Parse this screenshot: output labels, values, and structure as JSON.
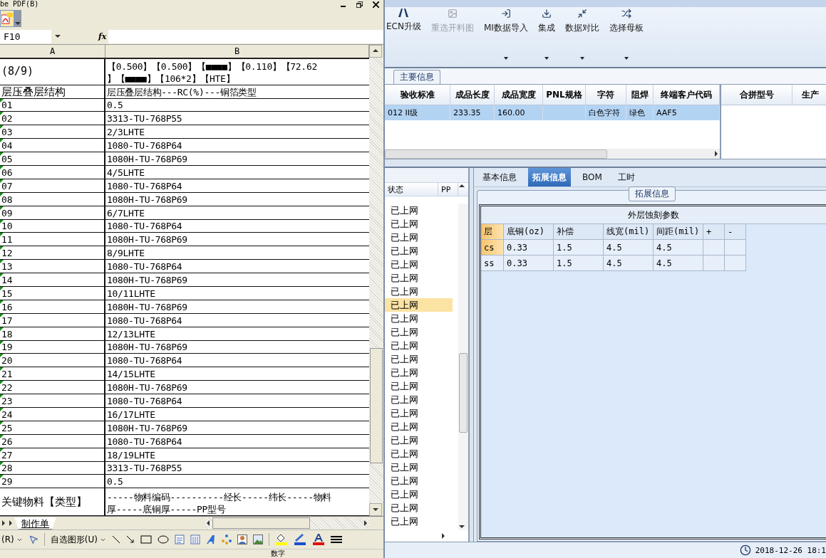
{
  "excel": {
    "menu_text": "be PDF(B)",
    "name_box": "F10",
    "formula_label": "fx",
    "columns": [
      "A",
      "B"
    ],
    "rows": [
      {
        "kind": "tall",
        "a": "(8/9)",
        "b": [
          "【0.500】【0.500】【■■■■】【0.110】【72.62",
          "】【■■■■】【106*2】【HTE】"
        ]
      },
      {
        "kind": "plain",
        "a": "层压叠层结构",
        "b": [
          "层压叠层结构---RC(%)---铜箔类型"
        ]
      },
      {
        "kind": "num",
        "a": "01",
        "b": [
          "0.5"
        ]
      },
      {
        "kind": "num",
        "a": "02",
        "b": [
          "3313-TU-768P55"
        ]
      },
      {
        "kind": "num",
        "a": "03",
        "b": [
          "2/3LHTE"
        ]
      },
      {
        "kind": "num",
        "a": "04",
        "b": [
          "1080-TU-768P64"
        ]
      },
      {
        "kind": "num",
        "a": "05",
        "b": [
          "1080H-TU-768P69"
        ]
      },
      {
        "kind": "num",
        "a": "06",
        "b": [
          "4/5LHTE"
        ]
      },
      {
        "kind": "num",
        "a": "07",
        "b": [
          "1080-TU-768P64"
        ]
      },
      {
        "kind": "num",
        "a": "08",
        "b": [
          "1080H-TU-768P69"
        ]
      },
      {
        "kind": "num",
        "a": "09",
        "b": [
          "6/7LHTE"
        ]
      },
      {
        "kind": "num",
        "a": "10",
        "b": [
          "1080-TU-768P64"
        ]
      },
      {
        "kind": "num",
        "a": "11",
        "b": [
          "1080H-TU-768P69"
        ]
      },
      {
        "kind": "num",
        "a": "12",
        "b": [
          "8/9LHTE"
        ]
      },
      {
        "kind": "num",
        "a": "13",
        "b": [
          "1080-TU-768P64"
        ]
      },
      {
        "kind": "num",
        "a": "14",
        "b": [
          "1080H-TU-768P69"
        ]
      },
      {
        "kind": "num",
        "a": "15",
        "b": [
          "10/11LHTE"
        ]
      },
      {
        "kind": "num",
        "a": "16",
        "b": [
          "1080H-TU-768P69"
        ]
      },
      {
        "kind": "num",
        "a": "17",
        "b": [
          "1080-TU-768P64"
        ]
      },
      {
        "kind": "num",
        "a": "18",
        "b": [
          "12/13LHTE"
        ]
      },
      {
        "kind": "num",
        "a": "19",
        "b": [
          "1080H-TU-768P69"
        ]
      },
      {
        "kind": "num",
        "a": "20",
        "b": [
          "1080-TU-768P64"
        ]
      },
      {
        "kind": "num",
        "a": "21",
        "b": [
          "14/15LHTE"
        ]
      },
      {
        "kind": "num",
        "a": "22",
        "b": [
          "1080H-TU-768P69"
        ]
      },
      {
        "kind": "num",
        "a": "23",
        "b": [
          "1080-TU-768P64"
        ]
      },
      {
        "kind": "num",
        "a": "24",
        "b": [
          "16/17LHTE"
        ]
      },
      {
        "kind": "num",
        "a": "25",
        "b": [
          "1080H-TU-768P69"
        ]
      },
      {
        "kind": "num",
        "a": "26",
        "b": [
          "1080-TU-768P64"
        ]
      },
      {
        "kind": "num",
        "a": "27",
        "b": [
          "18/19LHTE"
        ]
      },
      {
        "kind": "num",
        "a": "28",
        "b": [
          "3313-TU-768P55"
        ]
      },
      {
        "kind": "num",
        "a": "29",
        "b": [
          "0.5"
        ]
      },
      {
        "kind": "tall",
        "a": "关键物料【类型】",
        "b": [
          "-----物料编码----------经长-----纬长-----物料",
          "厚-----底铜厚-----PP型号"
        ]
      }
    ],
    "sheet_tab": "制作单",
    "draw_menu": "(R)",
    "autoshapes": "自选图形(U)",
    "status": "数字"
  },
  "app": {
    "ribbon": [
      {
        "label": "ECN升级",
        "disabled": false,
        "dropdown": false
      },
      {
        "label": "重选开料图",
        "disabled": true,
        "dropdown": false
      },
      {
        "label": "MI数据导入",
        "disabled": false,
        "dropdown": true
      },
      {
        "label": "集成",
        "disabled": false,
        "dropdown": true
      },
      {
        "label": "数据对比",
        "disabled": false,
        "dropdown": true
      },
      {
        "label": "选择母板",
        "disabled": false,
        "dropdown": true
      }
    ],
    "main_group": "主要信息",
    "grid": {
      "columns": [
        "验收标准",
        "成品长度",
        "成品宽度",
        "PNL规格",
        "字符",
        "阻焊",
        "终端客户代码"
      ],
      "rows": [
        {
          "selected": true,
          "cells": [
            {
              "text": "012 II级"
            },
            {
              "text": "233.35"
            },
            {
              "text": "160.00"
            },
            {},
            {
              "text": "白色字符"
            },
            {
              "text": "绿色"
            },
            {
              "text": "AAF5"
            }
          ]
        }
      ]
    },
    "side_grid": {
      "columns": [
        "合拼型号",
        "生产"
      ]
    },
    "list": {
      "columns": [
        "状态",
        "PP"
      ],
      "rows": [
        {
          "status": "已上网",
          "selected": false
        },
        {
          "status": "已上网",
          "selected": false
        },
        {
          "status": "已上网",
          "selected": false
        },
        {
          "status": "已上网",
          "selected": false
        },
        {
          "status": "已上网",
          "selected": false
        },
        {
          "status": "已上网",
          "selected": false
        },
        {
          "status": "已上网",
          "selected": false
        },
        {
          "status": "已上网",
          "selected": true
        },
        {
          "status": "已上网",
          "selected": false
        },
        {
          "status": "已上网",
          "selected": false
        },
        {
          "status": "已上网",
          "selected": false
        },
        {
          "status": "已上网",
          "selected": false
        },
        {
          "status": "已上网",
          "selected": false
        },
        {
          "status": "已上网",
          "selected": false
        },
        {
          "status": "已上网",
          "selected": false
        },
        {
          "status": "已上网",
          "selected": false
        },
        {
          "status": "已上网",
          "selected": false
        },
        {
          "status": "已上网",
          "selected": false
        },
        {
          "status": "已上网",
          "selected": false
        },
        {
          "status": "已上网",
          "selected": false
        },
        {
          "status": "已上网",
          "selected": false
        },
        {
          "status": "已上网",
          "selected": false
        },
        {
          "status": "已上网",
          "selected": false
        },
        {
          "status": "已上网",
          "selected": false
        }
      ]
    },
    "tabs": [
      {
        "label": "基本信息",
        "selected": false
      },
      {
        "label": "拓展信息",
        "selected": true
      },
      {
        "label": "BOM",
        "selected": false
      },
      {
        "label": "工时",
        "selected": false
      }
    ],
    "ext_group": "拓展信息",
    "etch_table": {
      "title": "外层蚀刻参数",
      "columns": [
        "层",
        "底铜(oz)",
        "补偿",
        "线宽(mil)",
        "间距(mil)",
        "+",
        "-"
      ],
      "rows": [
        {
          "selected": true,
          "cells": [
            "cs",
            "0.33",
            "1.5",
            "4.5",
            "4.5"
          ]
        },
        {
          "selected": false,
          "cells": [
            "ss",
            "0.33",
            "1.5",
            "4.5",
            "4.5"
          ]
        }
      ]
    },
    "status_time": "2018-12-26 18:1"
  }
}
